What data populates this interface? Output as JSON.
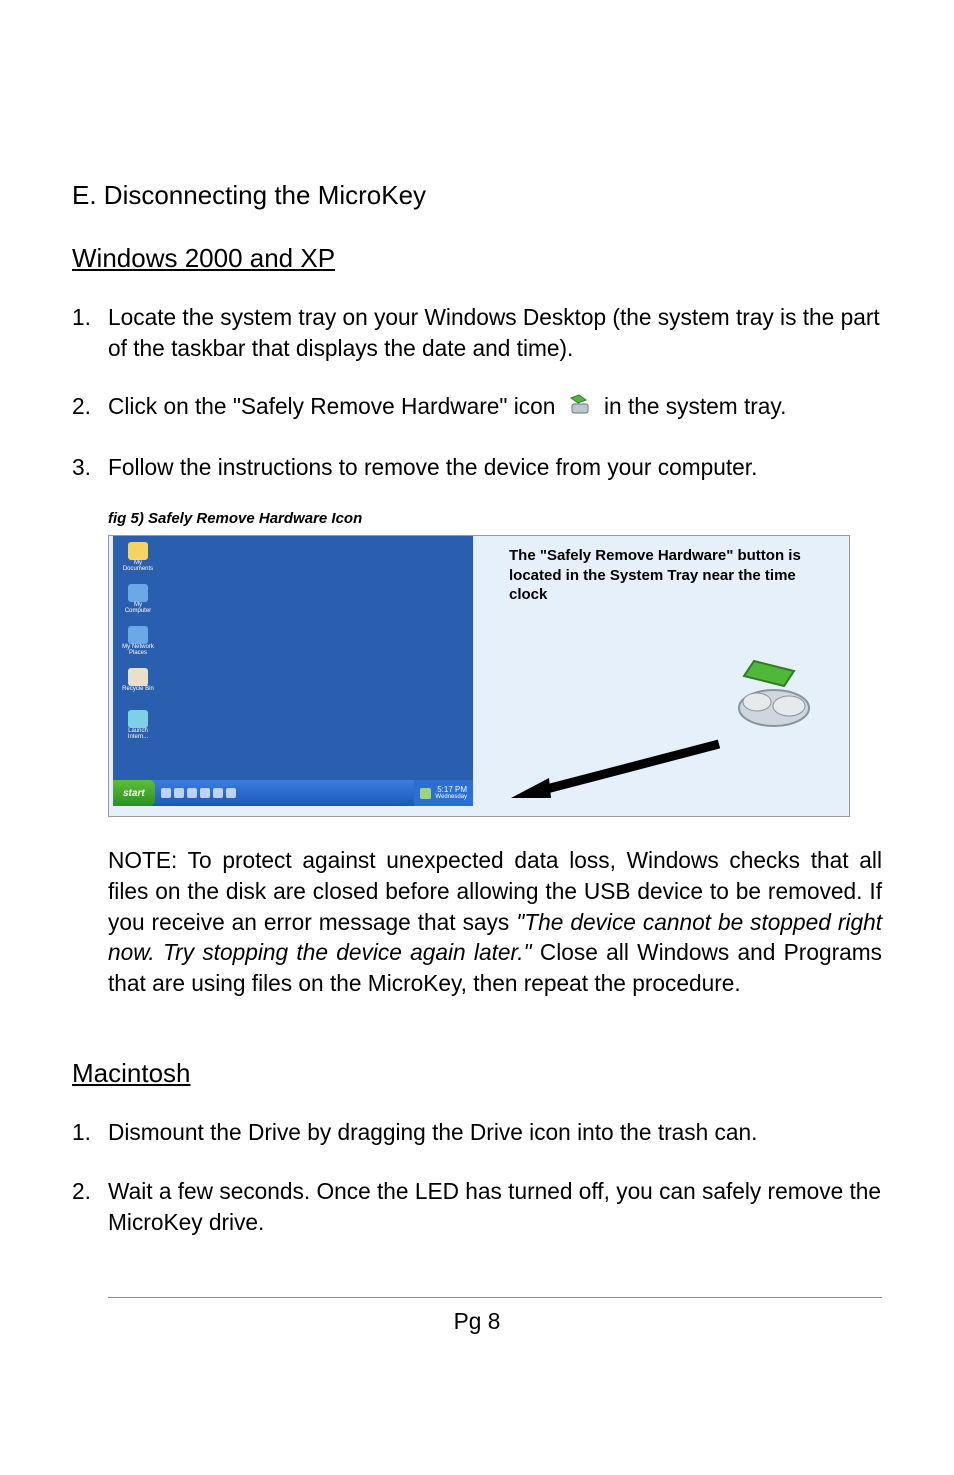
{
  "title": "E.  Disconnecting the MicroKey",
  "win": {
    "heading": "Windows 2000 and XP",
    "items": [
      {
        "num": "1.",
        "text": "Locate the system tray on your Windows Desktop (the system tray is the part of the taskbar that displays the date and time)."
      },
      {
        "num": "2.",
        "pre": "Click on the \"Safely Remove Hardware\" icon",
        "post": "in the system tray."
      },
      {
        "num": "3.",
        "text": "Follow the instructions  to remove the device from your computer."
      }
    ]
  },
  "fig": {
    "caption": "fig 5) Safely Remove Hardware Icon",
    "callout": "The \"Safely Remove Hardware\" button is located in the System Tray near the time clock",
    "start": "start",
    "clock": "5:17 PM",
    "weekday": "Wednesday",
    "desktop_icons": [
      "My Documents",
      "My Computer",
      "My Network Places",
      "Recycle Bin",
      "Launch Intern..."
    ]
  },
  "note": {
    "lead": "NOTE: To protect against unexpected data loss, Windows checks that all files on the disk are closed before allowing the USB device to be removed.  If you receive an error message that says ",
    "italic": "\"The device cannot be stopped right now. Try stopping the device again later.\"",
    "tail": "  Close all Windows and Programs that are using files on the MicroKey, then repeat the procedure."
  },
  "mac": {
    "heading": "Macintosh",
    "items": [
      {
        "num": "1.",
        "text": "Dismount the Drive by dragging the Drive icon into the trash can."
      },
      {
        "num": "2.",
        "text": "Wait a few seconds.  Once the LED has turned off, you can safely remove the MicroKey drive."
      }
    ]
  },
  "footer": "Pg 8"
}
